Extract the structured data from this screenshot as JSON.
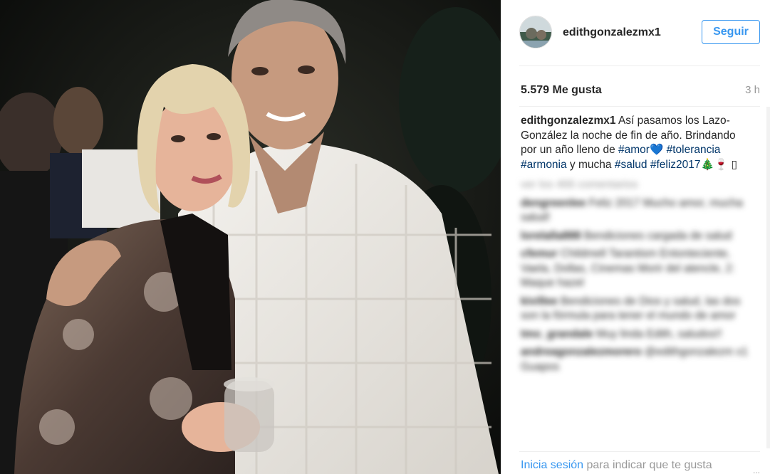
{
  "post": {
    "username": "edithgonzalezmx1",
    "follow_label": "Seguir",
    "likes": "5.579 Me gusta",
    "time": "3 h",
    "caption_user": "edithgonzalezmx1",
    "caption_text_1": " Así pasamos los Lazo-González la noche de fin de año. Brindando por un año lleno de ",
    "tag_amor": "#amor",
    "heart_emoji": "💙",
    "tag_tolerancia": "#tolerancia",
    "tag_armonia": "#armonia",
    "caption_text_2": " y mucha ",
    "tag_salud": "#salud",
    "tag_feliz": "#feliz2017",
    "tree_emoji": "🎄",
    "glass_emoji": "🍷",
    "box_char": "▯"
  },
  "comments": {
    "load_more": "ver los 466 comentarios",
    "items": [
      {
        "user": "dengreenlee",
        "text": "Feliz 2017 Mucho amor, mucha salud!"
      },
      {
        "user": "lorelalla888",
        "text": "Bendiciones cargada de salud"
      },
      {
        "user": "cfemur",
        "text": "Childmell Tarantism Entonteciente, Vaela, Dollas, Cinemas Morir del atencle, 2: Maque hazel"
      },
      {
        "user": "kivillee",
        "text": "Bendiciones de Dios y salud, las dos son la fórmula para tener el mundo de amor"
      },
      {
        "user": "tmo_grandale",
        "text": "Muy linda Edith, saludos!!"
      },
      {
        "user": "andreagonzalezmorero",
        "text": "@edithgonzalezm x1 Guapos"
      }
    ]
  },
  "footer": {
    "login_link": "Inicia sesión",
    "login_text": " para indicar que te gusta",
    "more": "..."
  }
}
